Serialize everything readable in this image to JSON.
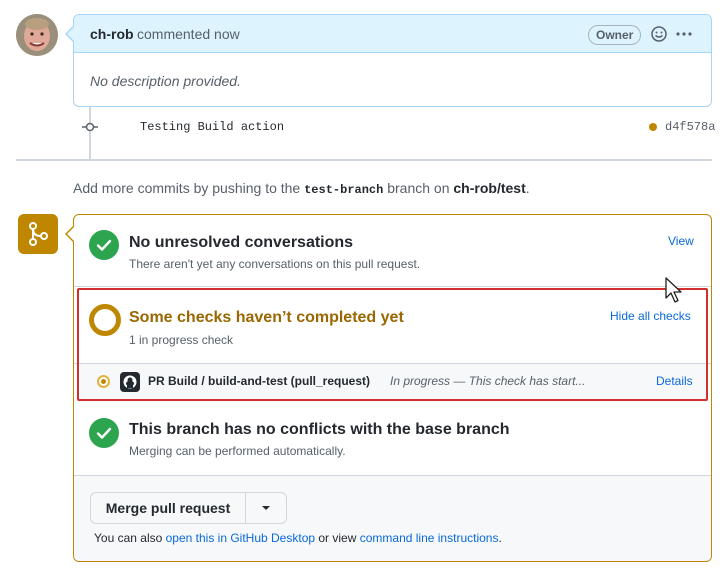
{
  "comment": {
    "author": "ch-rob",
    "action": "commented now",
    "badge": "Owner",
    "body": "No description provided.",
    "icons": [
      "smiley-icon",
      "kebab-horizontal-icon"
    ]
  },
  "commit": {
    "message": "Testing Build action",
    "sha": "d4f578a",
    "status_color": "#bf8700"
  },
  "hint": {
    "prefix": "Add more commits by pushing to the ",
    "branch": "test-branch",
    "middle": " branch on ",
    "repo": "ch-rob/test",
    "suffix": "."
  },
  "merge": {
    "conversations": {
      "title": "No unresolved conversations",
      "subtitle": "There aren't yet any conversations on this pull request.",
      "action": "View"
    },
    "checks": {
      "title": "Some checks haven’t completed yet",
      "subtitle": "1 in progress check",
      "action": "Hide all checks",
      "items": [
        {
          "name": "PR Build / build-and-test (pull_request)",
          "status": "In progress — This check has start...",
          "action": "Details"
        }
      ]
    },
    "conflicts": {
      "title": "This branch has no conflicts with the base branch",
      "subtitle": "Merging can be performed automatically."
    },
    "button_label": "Merge pull request",
    "footer": {
      "prefix": "You can also ",
      "desktop_link": "open this in GitHub Desktop",
      "middle": " or view ",
      "cli_link": "command line instructions",
      "suffix": "."
    }
  },
  "colors": {
    "accent": "#0969da",
    "success": "#2da44e",
    "pending": "#bf8700",
    "highlight": "#d32f2f"
  }
}
